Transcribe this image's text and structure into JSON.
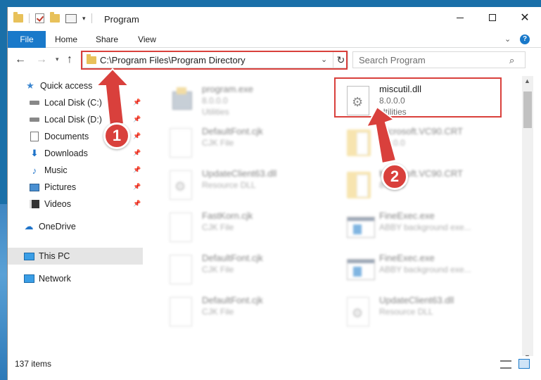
{
  "window": {
    "title": "Program",
    "minimize_glyph": "—",
    "close_glyph": "✕"
  },
  "ribbon": {
    "tabs": [
      "File",
      "Home",
      "Share",
      "View"
    ],
    "chevron": "⌄",
    "help": "?"
  },
  "nav": {
    "back": "←",
    "forward": "→",
    "recent": "▾",
    "up": "↑",
    "address": "C:\\Program Files\\Program Directory",
    "address_dropdown": "⌄",
    "refresh": "↻",
    "search_placeholder": "Search Program",
    "search_glyph": "⌕"
  },
  "sidebar": {
    "items": [
      {
        "label": "Quick access",
        "icon": "star-icon",
        "glyph": "★"
      },
      {
        "label": "Local Disk (C:)",
        "icon": "drive-icon",
        "pinned": true
      },
      {
        "label": "Local Disk (D:)",
        "icon": "drive-icon",
        "pinned": true
      },
      {
        "label": "Documents",
        "icon": "documents-icon",
        "pinned": true
      },
      {
        "label": "Downloads",
        "icon": "download-icon",
        "glyph": "⬇",
        "pinned": true
      },
      {
        "label": "Music",
        "icon": "music-icon",
        "glyph": "♪",
        "pinned": true
      },
      {
        "label": "Pictures",
        "icon": "pictures-icon",
        "pinned": true
      },
      {
        "label": "Videos",
        "icon": "videos-icon",
        "pinned": true
      },
      {
        "label": "OneDrive",
        "icon": "cloud-icon",
        "glyph": "☁"
      },
      {
        "label": "This PC",
        "icon": "computer-icon",
        "selected": true
      },
      {
        "label": "Network",
        "icon": "network-icon"
      }
    ],
    "pin_glyph": "📌"
  },
  "files": [
    {
      "name": "program.exe",
      "line1": "8.0.0.0",
      "line2": "Utilities",
      "icon": "setup-exe-icon"
    },
    {
      "name": "miscutil.dll",
      "line1": "8.0.0.0",
      "line2": "Utilities",
      "icon": "dll-gear-icon"
    },
    {
      "name": "DefaultFont.cjk",
      "line1": "CJK File",
      "line2": "",
      "icon": "blank-file-icon"
    },
    {
      "name": "Microsoft.VC90.CRT",
      "line1": "8.0.0.0",
      "line2": "",
      "icon": "folder-icon"
    },
    {
      "name": "UpdateClient63.dll",
      "line1": "Resource DLL",
      "line2": "",
      "icon": "dll-gear-icon"
    },
    {
      "name": "Microsoft.VC90.CRT",
      "line1": "8.0.0.0",
      "line2": "",
      "icon": "folder-icon"
    },
    {
      "name": "FastKorn.cjk",
      "line1": "CJK File",
      "line2": "",
      "icon": "blank-file-icon"
    },
    {
      "name": "FineExec.exe",
      "line1": "ABBY background exe...",
      "line2": "",
      "icon": "app-window-icon"
    },
    {
      "name": "DefaultFont.cjk",
      "line1": "CJK File",
      "line2": "",
      "icon": "blank-file-icon"
    },
    {
      "name": "FineExec.exe",
      "line1": "ABBY background exe...",
      "line2": "",
      "icon": "app-window-icon"
    },
    {
      "name": "DefaultFont.cjk",
      "line1": "CJK File",
      "line2": "",
      "icon": "blank-file-icon"
    },
    {
      "name": "UpdateClient63.dll",
      "line1": "Resource DLL",
      "line2": "",
      "icon": "dll-gear-icon"
    }
  ],
  "status": {
    "item_count": "137 items"
  },
  "callouts": [
    "1",
    "2"
  ],
  "colors": {
    "accent": "#1979ca",
    "highlight": "#d9403c",
    "selected_bg": "#e5e5e5"
  }
}
